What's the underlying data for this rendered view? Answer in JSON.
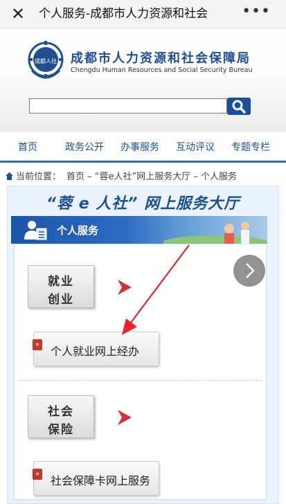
{
  "topbar": {
    "close_glyph": "✕",
    "title": "个人服务-成都市人力资源和社会",
    "more_glyph": "•••"
  },
  "header": {
    "emblem_text": "成都人社",
    "org_name_cn": "成都市人力资源和社会保障局",
    "org_name_en": "Chengdu Human Resources and Social Security Bureau"
  },
  "search": {
    "placeholder": "",
    "value": ""
  },
  "nav": {
    "items": [
      "首页",
      "政务公开",
      "办事服务",
      "互动评议",
      "专题专栏"
    ]
  },
  "breadcrumb": {
    "prefix": "当前位置：",
    "path": "首页 – “蓉e人社”网上服务大厅 – 个人服务"
  },
  "hall": {
    "title": "“蓉 e 人社” 网上服务大厅",
    "banner_label": "个人服务"
  },
  "categories": [
    {
      "line1": "就业",
      "line2": "创业",
      "service": "个人就业网上经办"
    },
    {
      "line1": "社会",
      "line2": "保险",
      "service": "社会保障卡网上服务"
    }
  ],
  "service_tag": "»",
  "colors": {
    "brand_blue": "#1e4f93",
    "nav_underline": "#2f6bb6",
    "arrow_red": "#d0313a"
  },
  "icons": [
    "close-icon",
    "more-icon",
    "emblem-icon",
    "search-icon",
    "home-icon",
    "user-card-icon",
    "chevron-right-icon",
    "red-arrow-icon"
  ]
}
